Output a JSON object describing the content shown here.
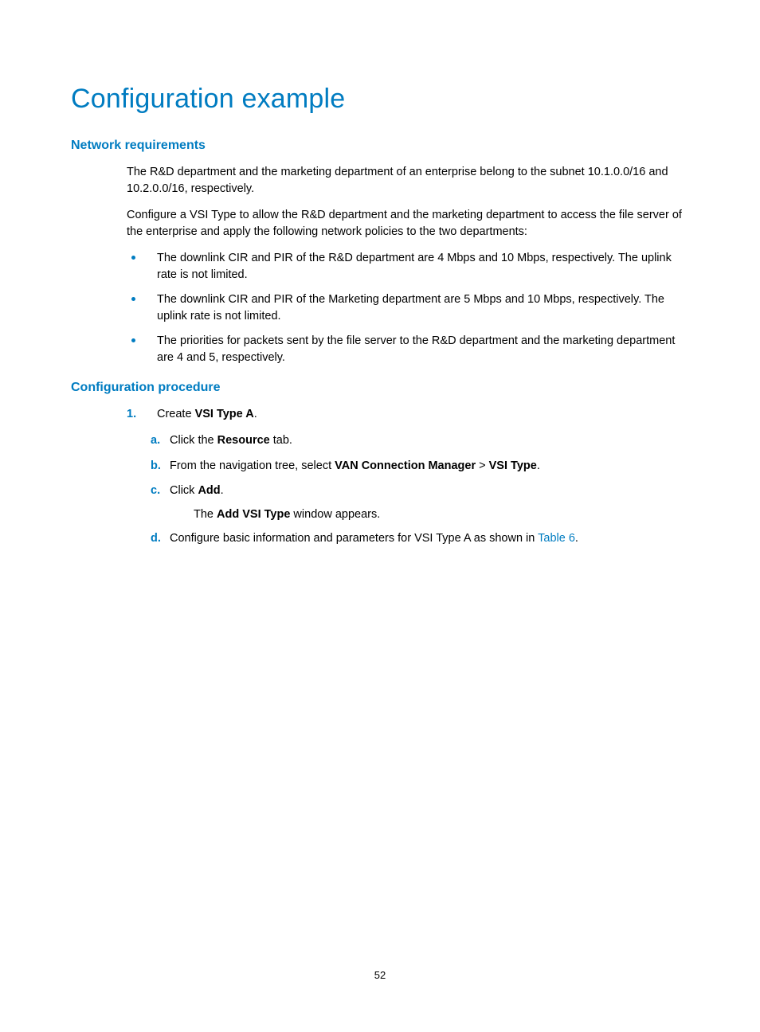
{
  "page_number": "52",
  "h1": "Configuration example",
  "sec1": {
    "heading": "Network requirements",
    "p1": "The R&D department and the marketing department of an enterprise belong to the subnet 10.1.0.0/16 and 10.2.0.0/16, respectively.",
    "p2": "Configure a VSI Type to allow the R&D department and the marketing department to access the file server of the enterprise and apply the following network policies to the two departments:",
    "bullets": [
      "The downlink CIR and PIR of the R&D department are 4 Mbps and 10 Mbps, respectively. The uplink rate is not limited.",
      "The downlink CIR and PIR of the Marketing department are 5 Mbps and 10 Mbps, respectively. The uplink rate is not limited.",
      "The priorities for packets sent by the file server to the R&D department and the marketing department are 4 and 5, respectively."
    ]
  },
  "sec2": {
    "heading": "Configuration procedure",
    "step1_num": "1.",
    "step1_pre": "Create ",
    "step1_bold": "VSI Type A",
    "step1_post": ".",
    "a_lbl": "a.",
    "a_pre": "Click the ",
    "a_bold": "Resource",
    "a_post": " tab.",
    "b_lbl": "b.",
    "b_pre": "From the navigation tree, select ",
    "b_bold1": "VAN Connection Manager",
    "b_mid": " > ",
    "b_bold2": "VSI Type",
    "b_post": ".",
    "c_lbl": "c.",
    "c_pre": "Click ",
    "c_bold": "Add",
    "c_post": ".",
    "c_note_pre": "The ",
    "c_note_bold": "Add VSI Type",
    "c_note_post": " window appears.",
    "d_lbl": "d.",
    "d_pre": "Configure basic information and parameters for VSI Type A as shown in ",
    "d_link": "Table 6",
    "d_post": "."
  }
}
